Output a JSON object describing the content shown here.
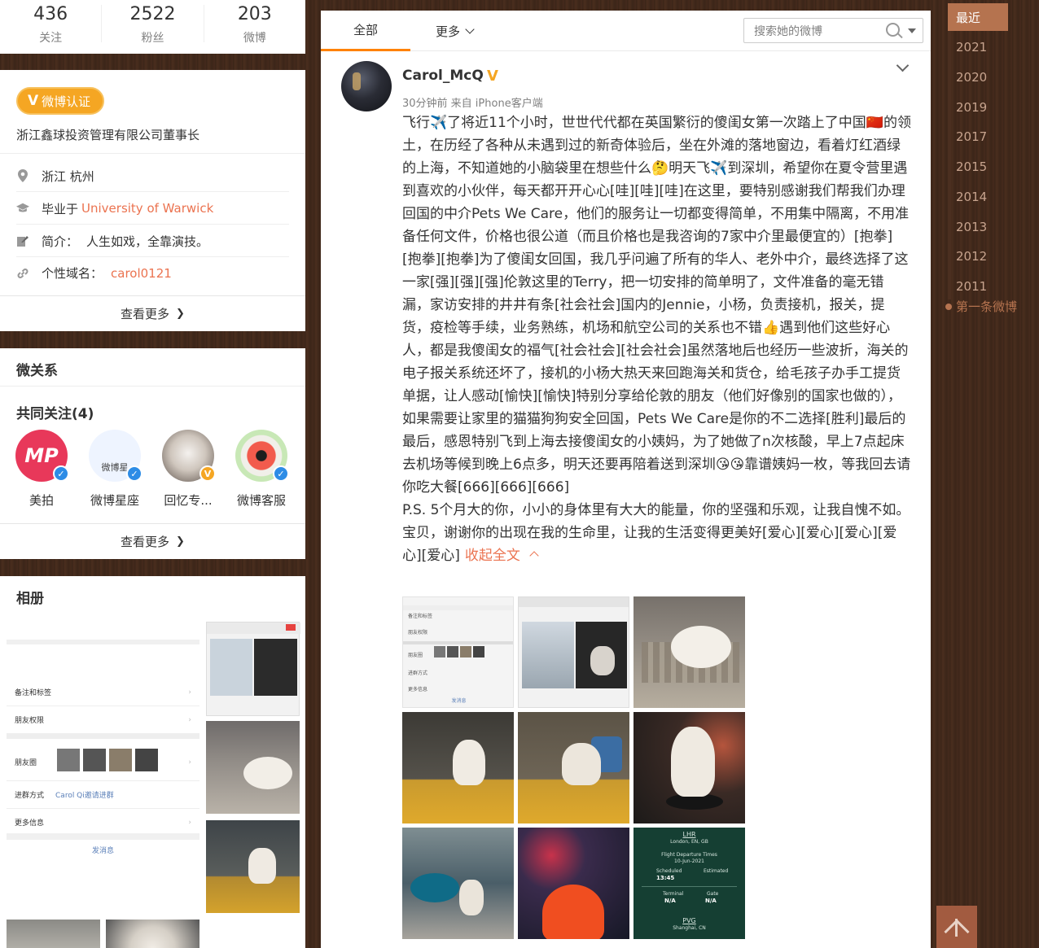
{
  "stats": [
    {
      "num": "436",
      "label": "关注"
    },
    {
      "num": "2522",
      "label": "粉丝"
    },
    {
      "num": "203",
      "label": "微博"
    }
  ],
  "profile": {
    "verify_badge": "微博认证",
    "verify_badge_mark": "V",
    "verify_text": "浙江鑫球投资管理有限公司董事长",
    "location": "浙江 杭州",
    "edu_prefix": "毕业于",
    "edu_school": "University of Warwick",
    "bio_label": "简介：",
    "bio": "人生如戏，全靠演技。",
    "domain_label": "个性域名：",
    "domain": "carol0121",
    "more": "查看更多"
  },
  "relations": {
    "title": "微关系",
    "common_title": "共同关注(4)",
    "friends": [
      {
        "name": "美拍",
        "color": "#e8385a",
        "badge": "#2d8ce6",
        "text": "MP"
      },
      {
        "name": "微博星座",
        "color": "#eef4ff",
        "badge": "#2d8ce6",
        "text": "微博星"
      },
      {
        "name": "回忆专...",
        "color": "#d8d2cc",
        "badge": "#f5a623",
        "text": ""
      },
      {
        "name": "微博客服",
        "color": "#c8e8b6",
        "badge": "#2d8ce6",
        "text": ""
      }
    ],
    "more": "查看更多"
  },
  "album": {
    "title": "相册",
    "rows": [
      "备注和标签",
      "朋友权限",
      "朋友圈",
      "进群方式",
      "更多信息"
    ],
    "invite": "Carol Qi邀请进群",
    "send": "发消息"
  },
  "tabs": {
    "all": "全部",
    "more": "更多"
  },
  "search": {
    "placeholder": "搜索她的微博"
  },
  "post": {
    "name": "Carol_McQ",
    "verify_mark": "V",
    "meta": "30分钟前 来自 iPhone客户端",
    "paragraph1": "飞行✈️了将近11个小时，世世代代都在英国繁衍的傻闺女第一次踏上了中国🇨🇳的领土，在历经了各种从未遇到过的新奇体验后，坐在外滩的落地窗边，看着灯红酒绿的上海，不知道她的小脑袋里在想些什么🤔明天飞✈️到深圳，希望你在夏令营里遇到喜欢的小伙伴，每天都开开心心[哇][哇][哇]在这里，要特别感谢我们帮我们办理回国的中介Pets We Care，他们的服务让一切都变得简单，不用集中隔离，不用准备任何文件，价格也很公道（而且价格也是我咨询的7家中介里最便宜的）[抱拳][抱拳][抱拳]为了傻闺女回国，我几乎问遍了所有的华人、老外中介，最终选择了这一家[强][强][强]伦敦这里的Terry，把一切安排的简单明了，文件准备的毫无错漏，家访安排的井井有条[社会社会]国内的Jennie，小杨，负责接机，报关，提货，疫检等手续，业务熟练，机场和航空公司的关系也不错👍遇到他们这些好心人，都是我傻闺女的福气[社会社会][社会社会]虽然落地后也经历一些波折，海关的电子报关系统还坏了，接机的小杨大热天来回跑海关和货仓，给毛孩子办手工提货单据，让人感动[愉快][愉快]特别分享给伦敦的朋友（他们好像别的国家也做的），如果需要让家里的猫猫狗狗安全回国，Pets We Care是你的不二选择[胜利]最后的最后，感恩特别飞到上海去接傻闺女的小姨妈，为了她做了n次核酸，早上7点起床去机场等候到晚上6点多，明天还要再陪着送到深圳😘😘靠谱姨妈一枚，等我回去请你吃大餐[666][666][666]",
    "paragraph2": "P.S. 5个月大的你，小小的身体里有大大的能量，你的坚强和乐观，让我自愧不如。宝贝，谢谢你的出现在我的生命里，让我的生活变得更美好[爱心][爱心][爱心][爱心][爱心]",
    "collapse": "收起全文",
    "photos": [
      {
        "kind": "screenshot",
        "bg": "#f4f4f4"
      },
      {
        "kind": "screenshot2",
        "bg": "#e9e9e9"
      },
      {
        "kind": "dog-bed",
        "bg": "#8d8478"
      },
      {
        "kind": "dog-window",
        "bg": "#3c3a35"
      },
      {
        "kind": "dog-room",
        "bg": "#5b5346"
      },
      {
        "kind": "dog-table",
        "bg": "#2a2624"
      },
      {
        "kind": "dog-floor",
        "bg": "#4a5e68"
      },
      {
        "kind": "night-city",
        "bg": "#1d1f2b"
      },
      {
        "kind": "flight-board",
        "bg": "#153f33"
      }
    ],
    "flight": {
      "from": "LHR",
      "from_city": "London, EN, GB",
      "title": "Flight Departure Times",
      "date": "10-Jun-2021",
      "scheduled": "Scheduled",
      "estimated": "Estimated",
      "time": "13:45",
      "terminal": "Terminal",
      "gate": "Gate",
      "na": "N/A",
      "to": "PVG",
      "to_city": "Shanghai, CN"
    }
  },
  "timeline": {
    "items": [
      "最近",
      "2021",
      "2020",
      "2019",
      "2017",
      "2015",
      "2014",
      "2013",
      "2012",
      "2011"
    ],
    "first": "第一条微博"
  }
}
